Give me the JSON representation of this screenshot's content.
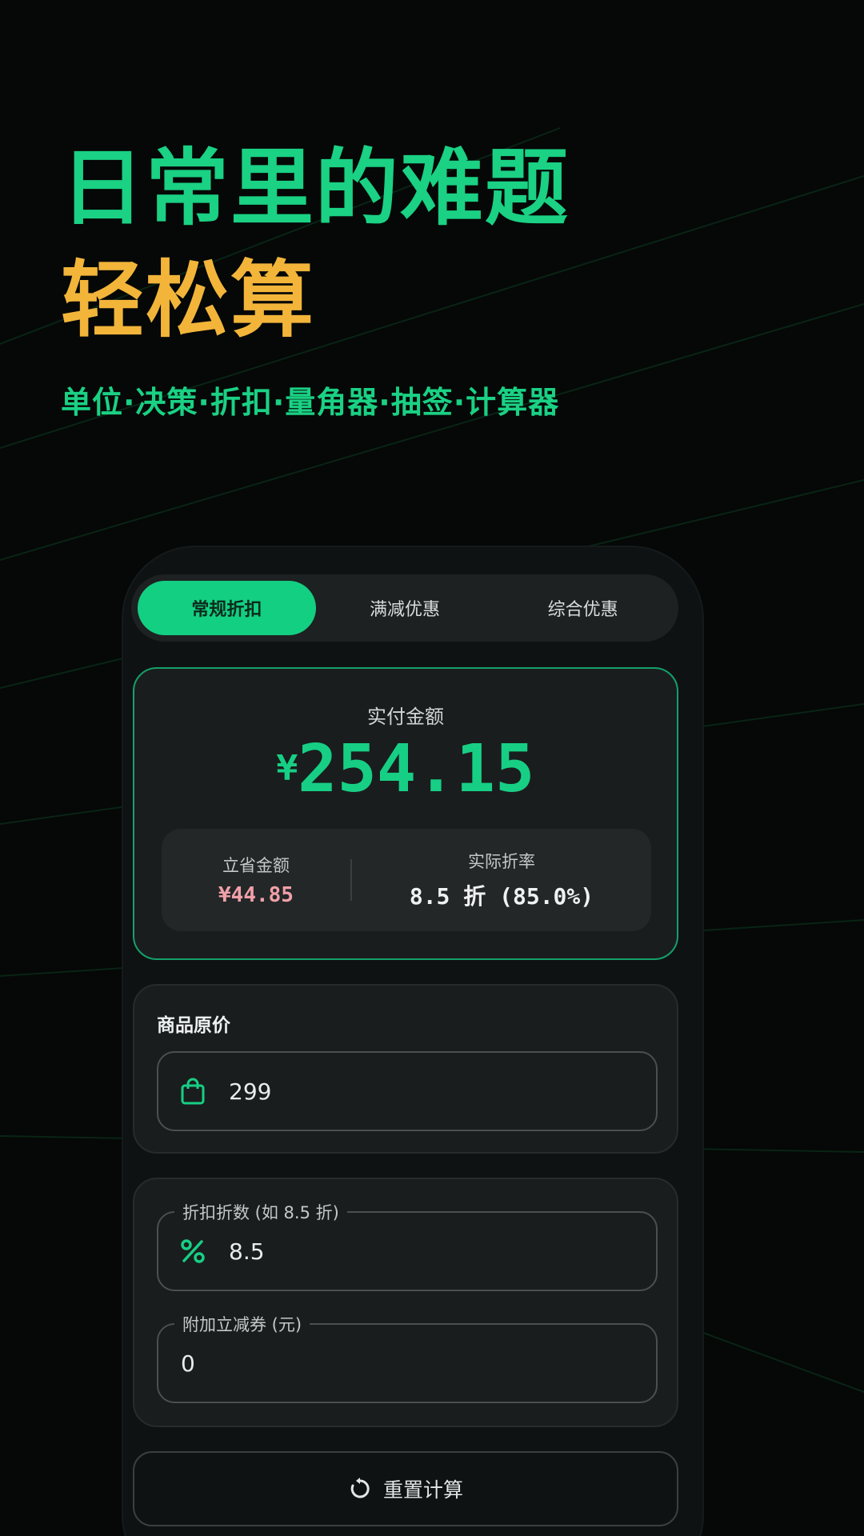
{
  "hero": {
    "title_line1": "日常里的难题",
    "title_line2": "轻松算",
    "subtitle": "单位·决策·折扣·量角器·抽签·计算器"
  },
  "tabs": [
    {
      "label": "常规折扣",
      "active": true
    },
    {
      "label": "满减优惠",
      "active": false
    },
    {
      "label": "综合优惠",
      "active": false
    }
  ],
  "result": {
    "label": "实付金额",
    "currency": "¥",
    "amount": "254.15",
    "saved_label": "立省金额",
    "saved_value": "¥44.85",
    "rate_label": "实际折率",
    "rate_value": "8.5 折 (85.0%)"
  },
  "price_card": {
    "title": "商品原价",
    "icon": "shopping-bag-icon",
    "value": "299"
  },
  "discount_card": {
    "discount_legend": "折扣折数 (如 8.5 折)",
    "discount_icon": "percent-icon",
    "discount_value": "8.5",
    "coupon_legend": "附加立减券 (元)",
    "coupon_value": "0"
  },
  "reset": {
    "label": "重置计算",
    "icon": "refresh-icon"
  },
  "colors": {
    "accent_green": "#13cf82",
    "accent_yellow": "#f2b53a",
    "saved_pink": "#f1a0a8",
    "background": "#050807"
  }
}
